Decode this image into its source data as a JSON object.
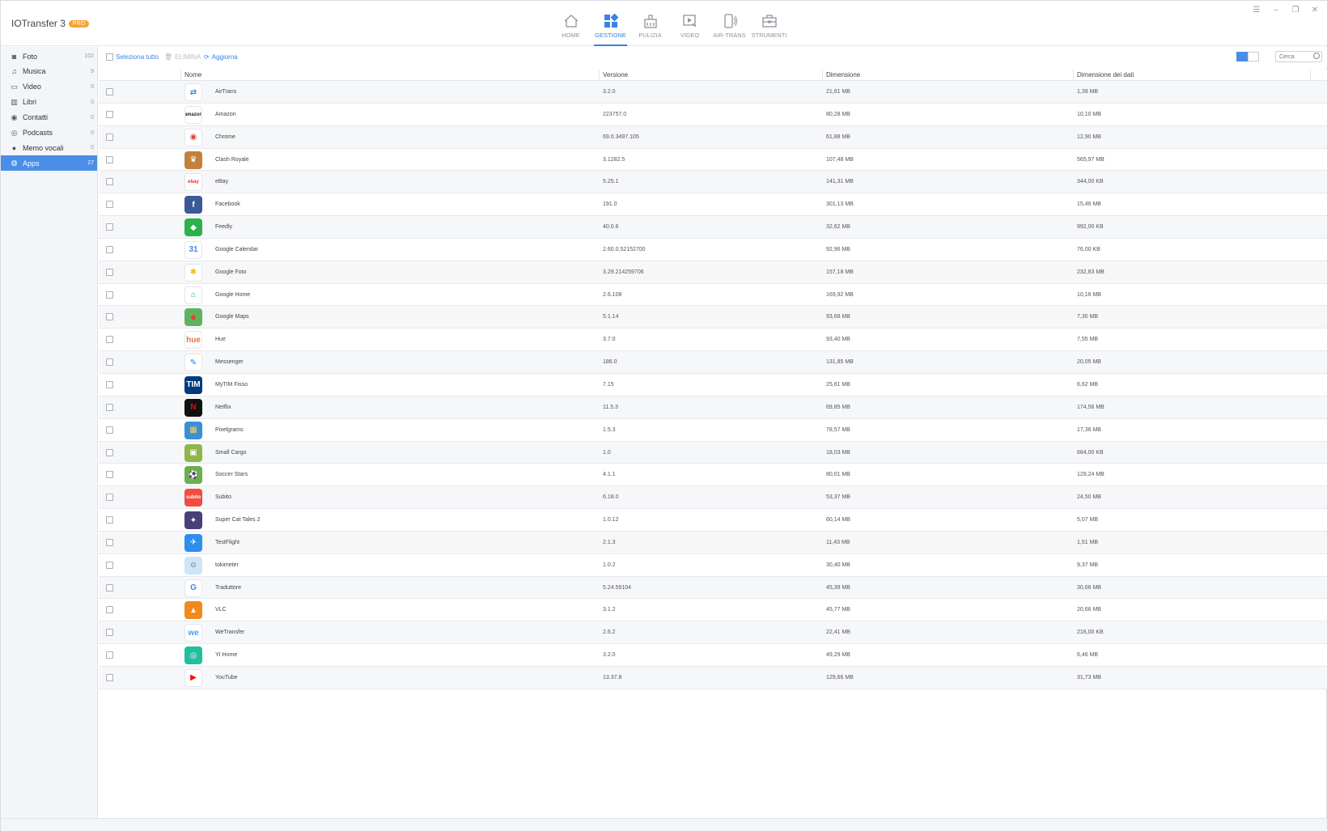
{
  "app": {
    "name": "IOTransfer 3",
    "badge": "PRO"
  },
  "nav": [
    {
      "label": "HOME",
      "icon": "home-icon"
    },
    {
      "label": "GESTIONE",
      "icon": "grid-icon",
      "active": true
    },
    {
      "label": "PULIZIA",
      "icon": "broom-icon"
    },
    {
      "label": "VIDEO",
      "icon": "video-icon"
    },
    {
      "label": "AIR-TRANS",
      "icon": "phone-transfer-icon"
    },
    {
      "label": "STRUMENTI",
      "icon": "toolbox-icon"
    }
  ],
  "sidebar": [
    {
      "label": "Foto",
      "count": "102",
      "icon": "camera-icon",
      "glyph": "◙"
    },
    {
      "label": "Musica",
      "count": "9",
      "icon": "music-note-icon",
      "glyph": "♫"
    },
    {
      "label": "Video",
      "count": "0",
      "icon": "film-icon",
      "glyph": "▭"
    },
    {
      "label": "Libri",
      "count": "0",
      "icon": "book-icon",
      "glyph": "▥"
    },
    {
      "label": "Contatti",
      "count": "0",
      "icon": "contact-icon",
      "glyph": "◉"
    },
    {
      "label": "Podcasts",
      "count": "0",
      "icon": "podcast-icon",
      "glyph": "◎"
    },
    {
      "label": "Memo vocali",
      "count": "0",
      "icon": "microphone-icon",
      "glyph": "●"
    },
    {
      "label": "Apps",
      "count": "27",
      "icon": "apps-icon",
      "glyph": "◍",
      "active": true
    }
  ],
  "toolbar": {
    "select_all": "Seleziona tutto",
    "delete": "ELIMINA",
    "refresh": "Aggiorna",
    "search_placeholder": "Cerca"
  },
  "columns": {
    "name": "Nome",
    "version": "Versione",
    "size": "Dimensione",
    "data_size": "Dimensione dei dati"
  },
  "colors": {
    "accent": "#3a82e4",
    "sidebar_active": "#4a8ee8",
    "badge": "#f2a43a"
  },
  "rows": [
    {
      "name": "AirTrans",
      "version": "3.2.0",
      "size": "21,61 MB",
      "data": "1,39 MB",
      "icon": "airtrans-icon",
      "bg": "#ffffff",
      "fg": "#3a82e4",
      "glyph": "⇄"
    },
    {
      "name": "Amazon",
      "version": "223757.0",
      "size": "80,28 MB",
      "data": "10,10 MB",
      "icon": "amazon-icon",
      "bg": "#ffffff",
      "fg": "#222222",
      "glyph": "amazon"
    },
    {
      "name": "Chrome",
      "version": "69.0.3497.105",
      "size": "61,88 MB",
      "data": "12,90 MB",
      "icon": "chrome-icon",
      "bg": "#ffffff",
      "fg": "#db4437",
      "glyph": "◉"
    },
    {
      "name": "Clash Royale",
      "version": "3.1282.5",
      "size": "107,48 MB",
      "data": "565,97 MB",
      "icon": "clash-royale-icon",
      "bg": "#c4813a",
      "fg": "#ffffff",
      "glyph": "♛"
    },
    {
      "name": "eBay",
      "version": "5.25.1",
      "size": "141,31 MB",
      "data": "344,00 KB",
      "icon": "ebay-icon",
      "bg": "#ffffff",
      "fg": "#e53238",
      "glyph": "ebay"
    },
    {
      "name": "Facebook",
      "version": "191.0",
      "size": "301,13 MB",
      "data": "15,46 MB",
      "icon": "facebook-icon",
      "bg": "#3b5998",
      "fg": "#ffffff",
      "glyph": "f"
    },
    {
      "name": "Feedly",
      "version": "40.0.6",
      "size": "32,62 MB",
      "data": "992,00 KB",
      "icon": "feedly-icon",
      "bg": "#2bb24c",
      "fg": "#ffffff",
      "glyph": "◆"
    },
    {
      "name": "Google Calendar",
      "version": "2.60.0.52152700",
      "size": "92,96 MB",
      "data": "76,00 KB",
      "icon": "google-calendar-icon",
      "bg": "#ffffff",
      "fg": "#4285f4",
      "glyph": "31"
    },
    {
      "name": "Google Foto",
      "version": "3.29.214259706",
      "size": "157,18 MB",
      "data": "232,83 MB",
      "icon": "google-photos-icon",
      "bg": "#ffffff",
      "fg": "#fbbc05",
      "glyph": "✱"
    },
    {
      "name": "Google Home",
      "version": "2.6.108",
      "size": "169,92 MB",
      "data": "10,16 MB",
      "icon": "google-home-icon",
      "bg": "#ffffff",
      "fg": "#34a853",
      "glyph": "⌂"
    },
    {
      "name": "Google Maps",
      "version": "5.1.14",
      "size": "93,68 MB",
      "data": "7,30 MB",
      "icon": "google-maps-icon",
      "bg": "#5fb35f",
      "fg": "#ea4335",
      "glyph": "◆"
    },
    {
      "name": "Hue",
      "version": "3.7.0",
      "size": "93,40 MB",
      "data": "7,55 MB",
      "icon": "hue-icon",
      "bg": "#ffffff",
      "fg": "#e8743b",
      "glyph": "hue"
    },
    {
      "name": "Messenger",
      "version": "186.0",
      "size": "131,85 MB",
      "data": "20,05 MB",
      "icon": "messenger-icon",
      "bg": "#ffffff",
      "fg": "#0084ff",
      "glyph": "✎"
    },
    {
      "name": "MyTIM Fisso",
      "version": "7.15",
      "size": "25,61 MB",
      "data": "6,62 MB",
      "icon": "mytim-icon",
      "bg": "#003a80",
      "fg": "#ffffff",
      "glyph": "TIM"
    },
    {
      "name": "Netflix",
      "version": "11.5.3",
      "size": "69,85 MB",
      "data": "174,56 MB",
      "icon": "netflix-icon",
      "bg": "#111111",
      "fg": "#e50914",
      "glyph": "N"
    },
    {
      "name": "Pixelgrams",
      "version": "1.5.3",
      "size": "78,57 MB",
      "data": "17,36 MB",
      "icon": "pixelgrams-icon",
      "bg": "#3a8fd9",
      "fg": "#ffd23f",
      "glyph": "▦"
    },
    {
      "name": "Small Cargo",
      "version": "1.0",
      "size": "18,03 MB",
      "data": "684,00 KB",
      "icon": "small-cargo-icon",
      "bg": "#8fb64a",
      "fg": "#ffffff",
      "glyph": "▣"
    },
    {
      "name": "Soccer Stars",
      "version": "4.1.1",
      "size": "80,01 MB",
      "data": "129,24 MB",
      "icon": "soccer-stars-icon",
      "bg": "#6ab04c",
      "fg": "#ffffff",
      "glyph": "⚽"
    },
    {
      "name": "Subito",
      "version": "6.18.0",
      "size": "53,37 MB",
      "data": "24,50 MB",
      "icon": "subito-icon",
      "bg": "#f04d40",
      "fg": "#ffffff",
      "glyph": "subito"
    },
    {
      "name": "Super Cat Tales 2",
      "version": "1.0.12",
      "size": "60,14 MB",
      "data": "5,07 MB",
      "icon": "super-cat-tales-icon",
      "bg": "#4b3f7a",
      "fg": "#ffffff",
      "glyph": "✦"
    },
    {
      "name": "TestFlight",
      "version": "2.1.3",
      "size": "11,43 MB",
      "data": "1,51 MB",
      "icon": "testflight-icon",
      "bg": "#2e8ef0",
      "fg": "#ffffff",
      "glyph": "✈"
    },
    {
      "name": "tokimeter",
      "version": "1.0.2",
      "size": "30,40 MB",
      "data": "9,37 MB",
      "icon": "tokimeter-icon",
      "bg": "#cfe4f5",
      "fg": "#335577",
      "glyph": "☺"
    },
    {
      "name": "Traduttore",
      "version": "5.24.59104",
      "size": "45,39 MB",
      "data": "30,66 MB",
      "icon": "google-translate-icon",
      "bg": "#ffffff",
      "fg": "#4285f4",
      "glyph": "G"
    },
    {
      "name": "VLC",
      "version": "3.1.2",
      "size": "45,77 MB",
      "data": "20,66 MB",
      "icon": "vlc-icon",
      "bg": "#f08a1c",
      "fg": "#ffffff",
      "glyph": "▲"
    },
    {
      "name": "WeTransfer",
      "version": "2.6.2",
      "size": "22,41 MB",
      "data": "216,00 KB",
      "icon": "wetransfer-icon",
      "bg": "#ffffff",
      "fg": "#409fff",
      "glyph": "we"
    },
    {
      "name": "YI Home",
      "version": "3.2.0",
      "size": "49,29 MB",
      "data": "6,46 MB",
      "icon": "yi-home-icon",
      "bg": "#1fbf9f",
      "fg": "#ffffff",
      "glyph": "◎"
    },
    {
      "name": "YouTube",
      "version": "13.37.8",
      "size": "129,66 MB",
      "data": "31,73 MB",
      "icon": "youtube-icon",
      "bg": "#ffffff",
      "fg": "#ff0000",
      "glyph": "▶"
    }
  ]
}
